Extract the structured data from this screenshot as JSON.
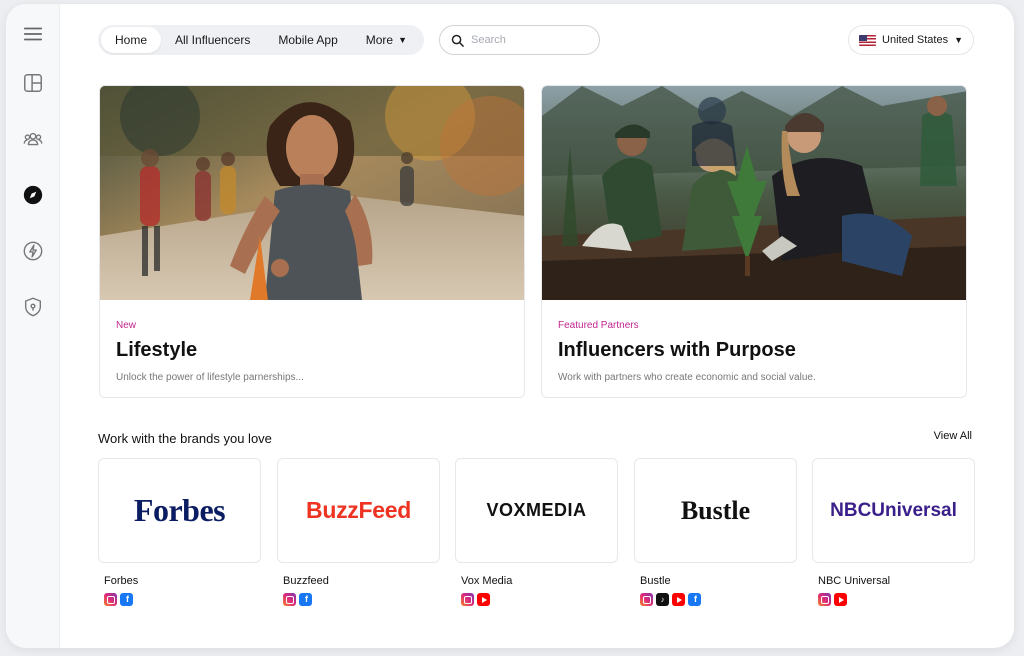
{
  "nav": {
    "tabs": [
      {
        "label": "Home",
        "active": true
      },
      {
        "label": "All Influencers"
      },
      {
        "label": "Mobile App"
      },
      {
        "label": "More"
      }
    ]
  },
  "search": {
    "placeholder": "Search",
    "value": ""
  },
  "country": {
    "label": "United States",
    "flag_icon": "us-flag-icon"
  },
  "sidebar": {
    "icons": [
      "menu-icon",
      "dashboard-icon",
      "people-icon",
      "compass-icon",
      "lightning-icon",
      "shield-icon"
    ],
    "active": "compass-icon"
  },
  "featured": [
    {
      "tag": "New",
      "title": "Lifestyle",
      "desc": "Unlock the power of lifestyle parnerships...",
      "image": "woman running in a race"
    },
    {
      "tag": "Featured Partners",
      "title": "Influencers with Purpose",
      "desc": "Work with partners who create economic and social value.",
      "image": "volunteers planting trees"
    }
  ],
  "brands_section": {
    "heading": "Work with the brands you love",
    "view_all": "View All",
    "brands": [
      {
        "logo_text": "Forbes",
        "name": "Forbes",
        "socials": [
          "instagram",
          "facebook"
        ]
      },
      {
        "logo_text": "BuzzFeed",
        "name": "Buzzfeed",
        "socials": [
          "instagram",
          "facebook"
        ]
      },
      {
        "logo_text": "VOXMEDIA",
        "name": "Vox Media",
        "socials": [
          "instagram",
          "youtube"
        ]
      },
      {
        "logo_text": "Bustle",
        "name": "Bustle",
        "socials": [
          "instagram",
          "tiktok",
          "youtube",
          "facebook"
        ]
      },
      {
        "logo_text": "NBCUniversal",
        "name": "NBC Universal",
        "socials": [
          "instagram",
          "youtube"
        ]
      }
    ]
  },
  "colors": {
    "accent_tag": "#c2258f",
    "forbes": "#0b1d62",
    "buzzfeed": "#ee3322",
    "nbc": "#3a1f8a"
  }
}
